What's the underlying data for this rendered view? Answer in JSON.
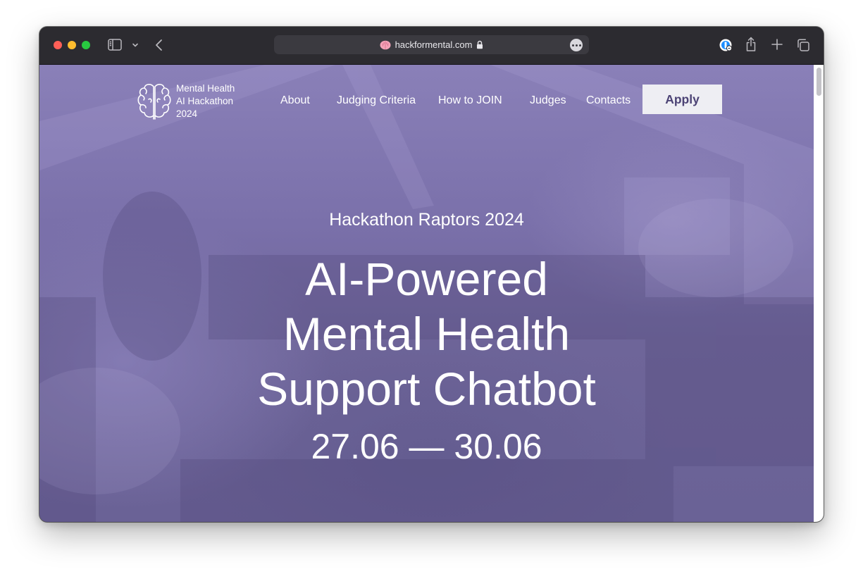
{
  "browser": {
    "url_text": "hackformental.com",
    "icons": [
      "sidebar-icon",
      "chevron-down-icon",
      "back-arrow-icon",
      "brain-favicon",
      "lock-icon",
      "more-icon",
      "password-icon",
      "share-icon",
      "plus-icon",
      "tabs-overview-icon"
    ]
  },
  "site": {
    "logo": {
      "line1": "Mental Health",
      "line2": "AI Hackathon",
      "line3": "2024",
      "icon": "brain-icon"
    },
    "nav": {
      "about": "About",
      "judging": "Judging Criteria",
      "how_to_join": "How to JOIN",
      "judges": "Judges",
      "contacts": "Contacts",
      "apply": "Apply"
    },
    "hero": {
      "eyebrow": "Hackathon Raptors 2024",
      "headline_1": "AI-Powered",
      "headline_2": "Mental Health",
      "headline_3": "Support Chatbot",
      "dates": "27.06 — 30.06"
    }
  },
  "colors": {
    "hero_overlay": "#7a70aa",
    "apply_bg": "#eeeef3",
    "apply_text": "#4c4375",
    "toolbar": "#2c2b30"
  }
}
